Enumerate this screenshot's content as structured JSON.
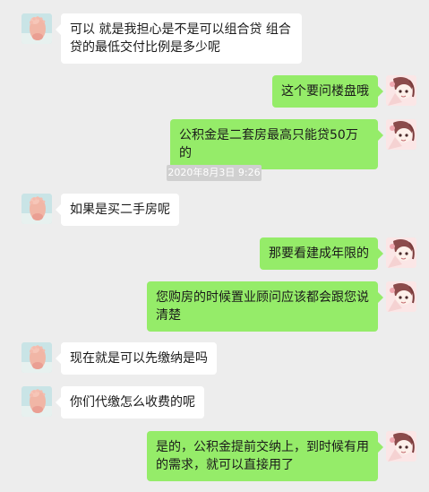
{
  "colors": {
    "background": "#ededed",
    "incoming_bubble": "#ffffff",
    "outgoing_bubble": "#95ec69",
    "timestamp_bg": "#d0d0d0"
  },
  "icons": {
    "contact_avatar": "baby-foot-photo-avatar",
    "user_avatar": "anime-character-avatar"
  },
  "timestamp": "2020年8月3日 9:26",
  "messages": [
    {
      "sender": "contact",
      "text": "可以  就是我担心是不是可以组合贷 组合贷的最低交付比例是多少呢"
    },
    {
      "sender": "me",
      "text": "这个要问楼盘哦"
    },
    {
      "sender": "me",
      "text": "公积金是二套房最高只能贷50万的"
    },
    {
      "sender": "contact",
      "text": "如果是买二手房呢"
    },
    {
      "sender": "me",
      "text": "那要看建成年限的"
    },
    {
      "sender": "me",
      "text": "您购房的时候置业顾问应该都会跟您说清楚"
    },
    {
      "sender": "contact",
      "text": "现在就是可以先缴纳是吗"
    },
    {
      "sender": "contact",
      "text": "你们代缴怎么收费的呢"
    },
    {
      "sender": "me",
      "text": "是的，公积金提前交纳上，到时候有用的需求，就可以直接用了"
    }
  ]
}
